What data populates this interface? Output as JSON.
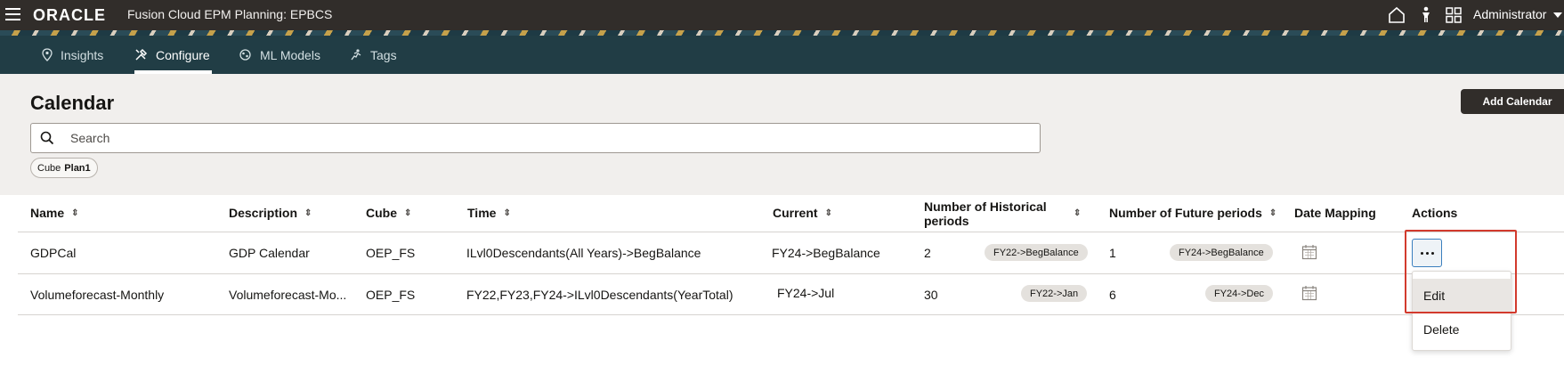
{
  "header": {
    "brand": "ORACLE",
    "app_title": "Fusion Cloud EPM Planning:  EPBCS",
    "user": "Administrator",
    "icons": [
      "menu-icon",
      "home-icon",
      "accessibility-icon",
      "navigator-icon",
      "chevron-down-icon"
    ]
  },
  "tabs": [
    {
      "label": "Insights",
      "icon": "location-pin-icon"
    },
    {
      "label": "Configure",
      "icon": "tools-icon",
      "active": true
    },
    {
      "label": "ML Models",
      "icon": "ml-icon"
    },
    {
      "label": "Tags",
      "icon": "tag-run-icon"
    }
  ],
  "page": {
    "title": "Calendar",
    "add_button": "Add Calendar",
    "search_placeholder": "Search",
    "filter_chip": {
      "label": "Cube",
      "value": "Plan1"
    }
  },
  "table": {
    "columns": [
      "Name",
      "Description",
      "Cube",
      "Time",
      "Current",
      "Number of Historical periods",
      "Number of Future periods",
      "Date Mapping",
      "Actions"
    ],
    "rows": [
      {
        "name": "GDPCal",
        "description": "GDP Calendar",
        "cube": "OEP_FS",
        "time": "ILvl0Descendants(All Years)->BegBalance",
        "current": "FY24->BegBalance",
        "historical_count": "2",
        "historical_start": "FY22->BegBalance",
        "future_count": "1",
        "future_end": "FY24->BegBalance"
      },
      {
        "name": "Volumeforecast-Monthly",
        "description": "Volumeforecast-Mo...",
        "cube": "OEP_FS",
        "time": "FY22,FY23,FY24->ILvl0Descendants(YearTotal)",
        "current": "FY24->Jul",
        "historical_count": "30",
        "historical_start": "FY22->Jan",
        "future_count": "6",
        "future_end": "FY24->Dec"
      }
    ]
  },
  "actions_menu": {
    "items": [
      "Edit",
      "Delete"
    ],
    "hovered": "Edit"
  },
  "colors": {
    "header_bg": "#312d2a",
    "tabbar_bg": "#213d45",
    "page_bg": "#f1efed",
    "highlight_border": "#d23a2d"
  }
}
